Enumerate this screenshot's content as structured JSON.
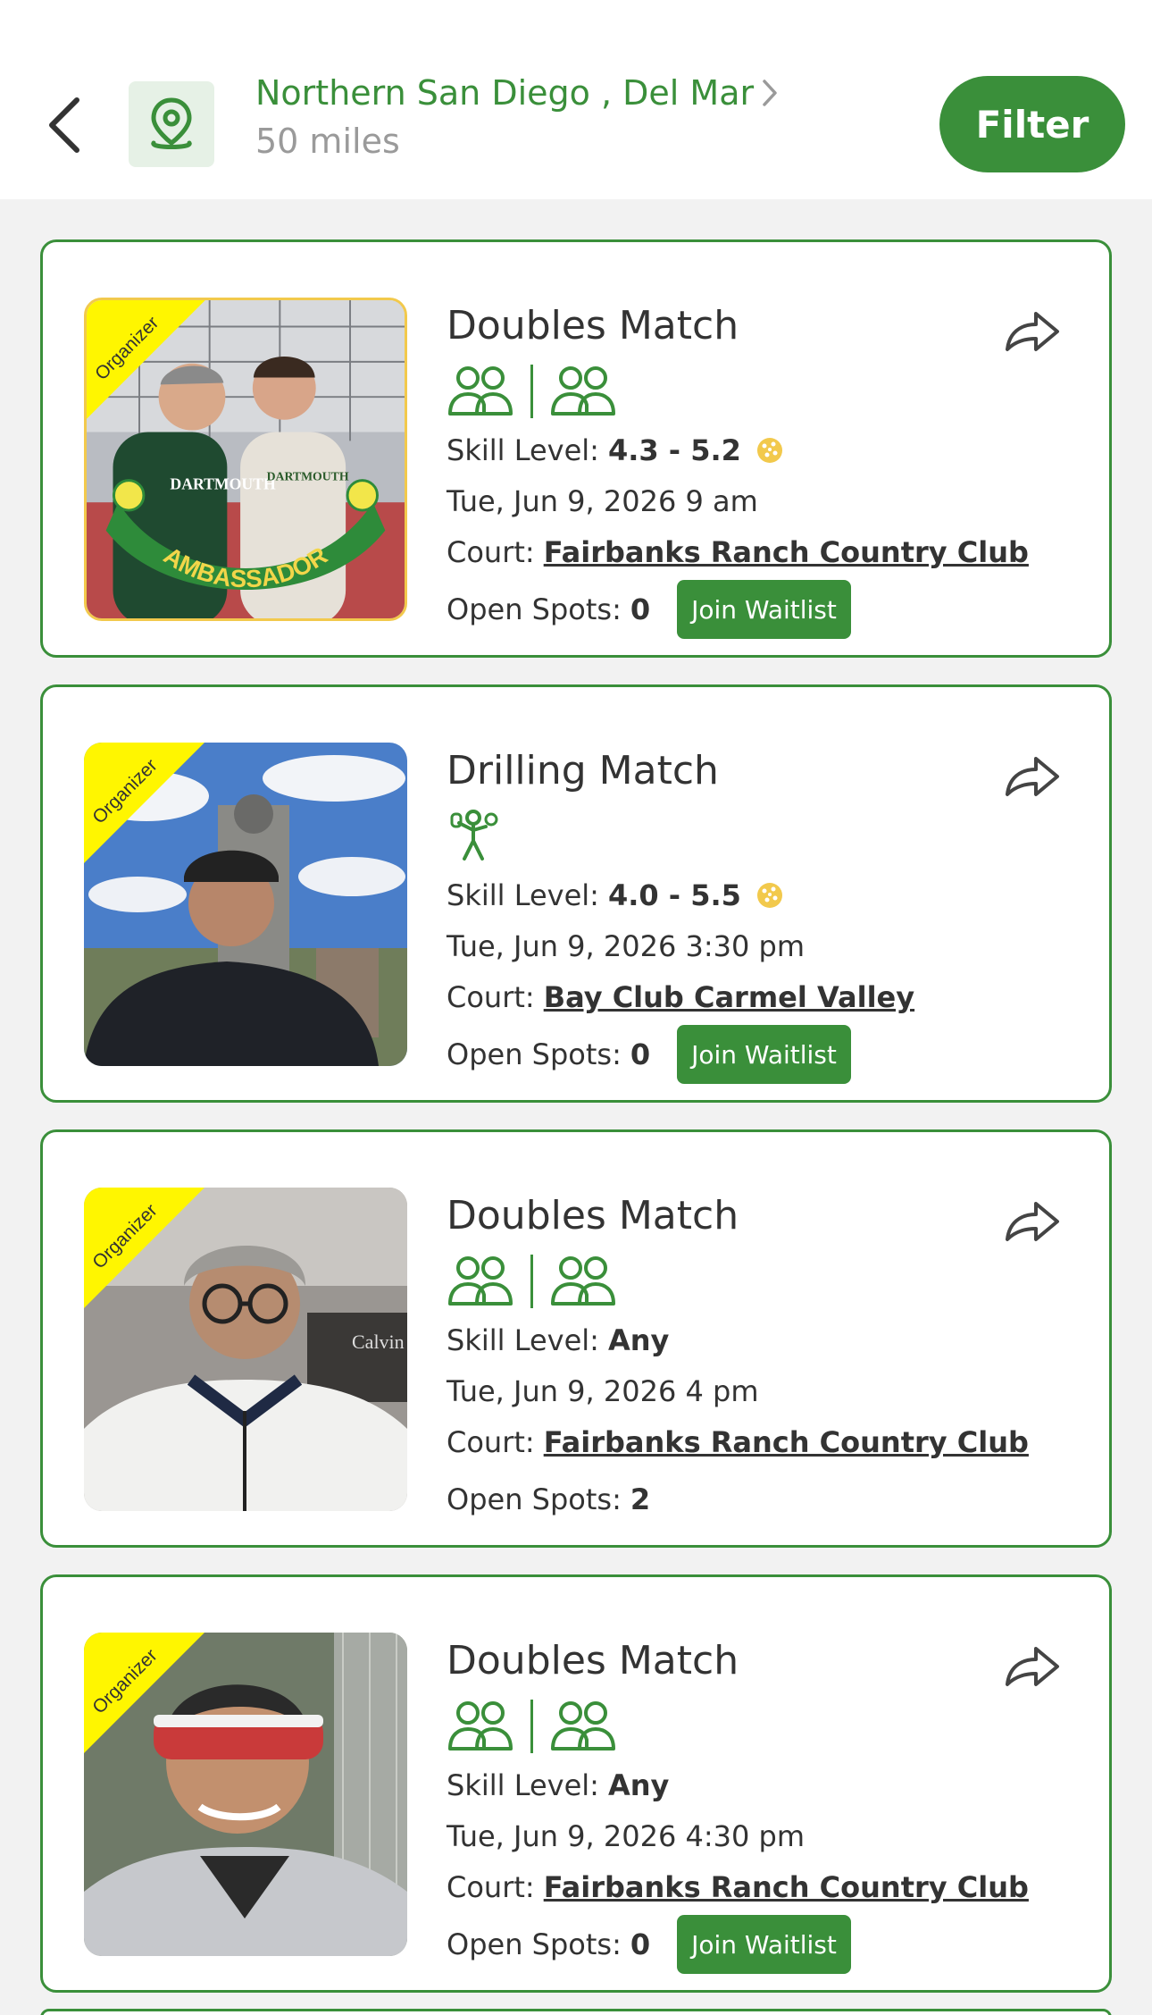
{
  "header": {
    "location_name": "Northern San Diego , Del Mar",
    "radius": "50 miles",
    "filter_label": "Filter",
    "icons": {
      "back": "chevron-left-icon",
      "location": "map-pin-icon",
      "forward": "chevron-right-icon"
    }
  },
  "colors": {
    "brand": "#3a8f3a",
    "badge": "#fff600",
    "ball": "#f2c94c"
  },
  "labels": {
    "organizer_badge": "Organizer",
    "skill_prefix": "Skill Level:",
    "court_prefix": "Court:",
    "spots_prefix": "Open Spots:",
    "join_waitlist": "Join Waitlist",
    "ambassador": "AMBASSADOR"
  },
  "matches": [
    {
      "title": "Doubles Match",
      "type": "doubles",
      "skill": "4.3 - 5.2",
      "rated": true,
      "datetime": "Tue, Jun 9, 2026 9 am",
      "court": "Fairbanks Ranch Country Club",
      "open_spots": "0",
      "waitlist": true,
      "ambassador": true,
      "photo_text": [
        "DARTMOUTH",
        "DARTMOUTH"
      ]
    },
    {
      "title": "Drilling Match",
      "type": "drilling",
      "skill": "4.0 - 5.5",
      "rated": true,
      "datetime": "Tue, Jun 9, 2026 3:30 pm",
      "court": "Bay Club Carmel Valley",
      "open_spots": "0",
      "waitlist": true,
      "ambassador": false
    },
    {
      "title": "Doubles Match",
      "type": "doubles",
      "skill": "Any",
      "rated": false,
      "datetime": "Tue, Jun 9, 2026 4 pm",
      "court": "Fairbanks Ranch Country Club",
      "open_spots": "2",
      "waitlist": false,
      "ambassador": false,
      "photo_text": [
        "Calvin"
      ]
    },
    {
      "title": "Doubles Match",
      "type": "doubles",
      "skill": "Any",
      "rated": false,
      "datetime": "Tue, Jun 9, 2026 4:30 pm",
      "court": "Fairbanks Ranch Country Club",
      "open_spots": "0",
      "waitlist": true,
      "ambassador": false
    }
  ]
}
